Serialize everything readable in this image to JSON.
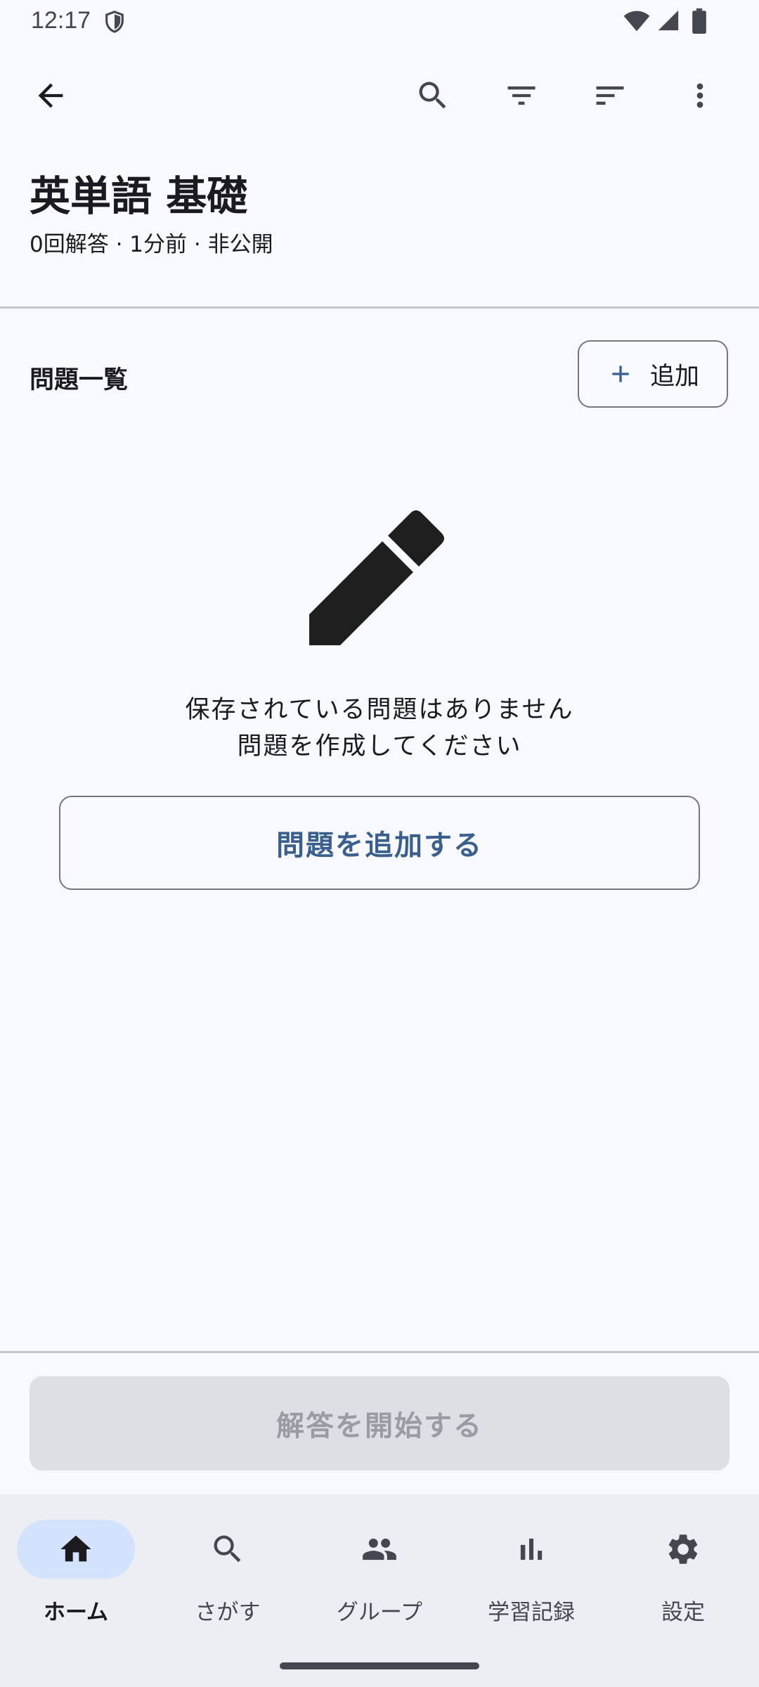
{
  "status_bar": {
    "time": "12:17"
  },
  "app_bar": {
    "back_icon": "arrow-back-icon",
    "actions": [
      "search-icon",
      "filter-icon",
      "sort-icon",
      "more-vert-icon"
    ]
  },
  "header": {
    "title": "英単語 基礎",
    "meta": "0回解答 · 1分前 · 非公開"
  },
  "section": {
    "title": "問題一覧",
    "add_label": "追加"
  },
  "empty_state": {
    "icon": "pencil-icon",
    "line1": "保存されている問題はありません",
    "line2": "問題を作成してください",
    "button_label": "問題を追加する"
  },
  "footer": {
    "start_label": "解答を開始する"
  },
  "bottom_nav": {
    "items": [
      {
        "label": "ホーム",
        "icon": "home-icon",
        "active": true
      },
      {
        "label": "さがす",
        "icon": "search-icon",
        "active": false
      },
      {
        "label": "グループ",
        "icon": "group-icon",
        "active": false
      },
      {
        "label": "学習記録",
        "icon": "bar-chart-icon",
        "active": false
      },
      {
        "label": "設定",
        "icon": "settings-icon",
        "active": false
      }
    ]
  },
  "colors": {
    "background": "#f7f9ff",
    "accent_text": "#3a5f8f",
    "nav_active_indicator": "#d3e3fd",
    "disabled_button": "#dedfe4"
  }
}
